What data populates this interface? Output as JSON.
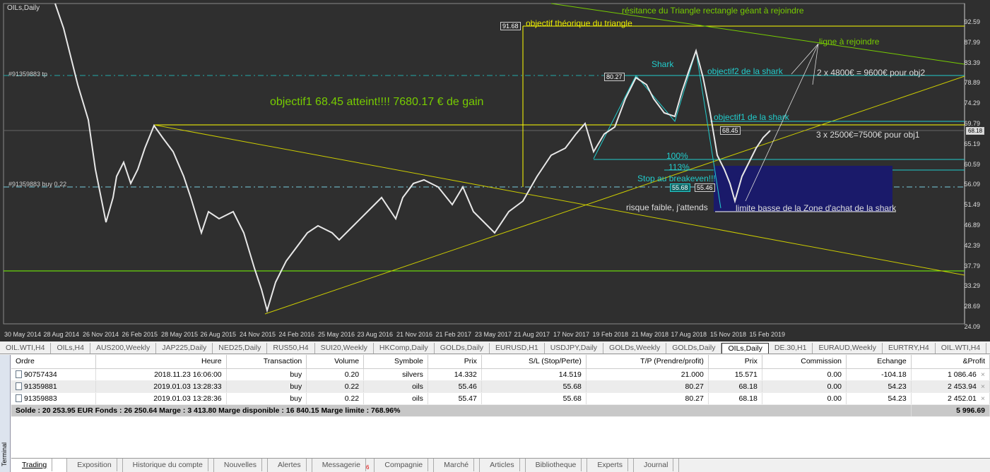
{
  "chart": {
    "title": "OILs,Daily",
    "price_axis": [
      "92.59",
      "87.99",
      "83.39",
      "78.89",
      "74.29",
      "69.79",
      "65.19",
      "60.59",
      "56.09",
      "51.49",
      "46.89",
      "42.39",
      "37.79",
      "33.29",
      "28.69",
      "24.09"
    ],
    "current_price": "68.18",
    "date_axis": [
      "30 May 2014",
      "28 Aug 2014",
      "26 Nov 2014",
      "26 Feb 2015",
      "28 May 2015",
      "26 Aug 2015",
      "24 Nov 2015",
      "24 Feb 2016",
      "25 May 2016",
      "23 Aug 2016",
      "21 Nov 2016",
      "21 Feb 2017",
      "23 May 2017",
      "21 Aug 2017",
      "17 Nov 2017",
      "19 Feb 2018",
      "21 May 2018",
      "17 Aug 2018",
      "15 Nov 2018",
      "15 Feb 2019"
    ],
    "annotations": {
      "resistance": "résitance du Triangle rectangle géant à rejoindre",
      "objectif_theorique": "objectif théorique du triangle",
      "obj_box": "91.68",
      "shark": "Shark",
      "box_8027": "80.27",
      "objectif2": "objectif2 de la shark",
      "ligne": "ligne à rejoindre",
      "obj2_gain": "2 x 4800€ = 9600€ pour obj2",
      "objectif1_atteint": "objectif1 68.45 atteint!!!! 7680.17 € de gain",
      "objectif1": "objectif1 de la shark",
      "box_6845": "68.45",
      "obj1_gain": "3 x 2500€=7500€ pour obj1",
      "pct100": "100%",
      "pct113": "113%",
      "stop": "Stop au breakeven!!!",
      "box_5568": "55.68",
      "box_5546": "55.46",
      "risque": "risque faible, j'attends",
      "limite": "limite basse de la Zone d'achat de la shark",
      "tp_label": "#91359883 tp",
      "buy_label": "#91359883 buy 0.22"
    }
  },
  "chart_tabs": [
    "OIL.WTI,H4",
    "OILs,H4",
    "AUS200,Weekly",
    "JAP225,Daily",
    "NED25,Daily",
    "RUS50,H4",
    "SUI20,Weekly",
    "HKComp,Daily",
    "GOLDs,Daily",
    "EURUSD,H1",
    "USDJPY,Daily",
    "GOLDs,Weekly",
    "GOLDs,Daily",
    "OILs,Daily",
    "DE.30,H1",
    "EURAUD,Weekly",
    "EURTRY,H4",
    "OIL.WTI,H4"
  ],
  "active_chart_tab": "OILs,Daily",
  "terminal": {
    "label": "Terminal",
    "columns": [
      "Ordre",
      "Heure",
      "Transaction",
      "Volume",
      "Symbole",
      "Prix",
      "S/L (Stop/Perte)",
      "T/P (Prendre/profit)",
      "Prix",
      "Commission",
      "Echange",
      "&Profit"
    ],
    "rows": [
      [
        "90757434",
        "2018.11.23 16:06:00",
        "buy",
        "0.20",
        "silvers",
        "14.332",
        "14.519",
        "21.000",
        "15.571",
        "0.00",
        "-104.18",
        "1 086.46"
      ],
      [
        "91359881",
        "2019.01.03 13:28:33",
        "buy",
        "0.22",
        "oils",
        "55.46",
        "55.68",
        "80.27",
        "68.18",
        "0.00",
        "54.23",
        "2 453.94"
      ],
      [
        "91359883",
        "2019.01.03 13:28:36",
        "buy",
        "0.22",
        "oils",
        "55.47",
        "55.68",
        "80.27",
        "68.18",
        "0.00",
        "54.23",
        "2 452.01"
      ]
    ],
    "summary": "Solde : 20 253.95 EUR  Fonds : 26 250.64  Marge : 3 413.80  Marge disponible : 16 840.15  Marge limite : 768.96%",
    "total_profit": "5 996.69",
    "tabs": [
      "Trading",
      "Exposition",
      "Historique du compte",
      "Nouvelles",
      "Alertes",
      "Messagerie",
      "Compagnie",
      "Marché",
      "Articles",
      "Bibliotheque",
      "Experts",
      "Journal"
    ],
    "messagerie_badge": "6"
  }
}
